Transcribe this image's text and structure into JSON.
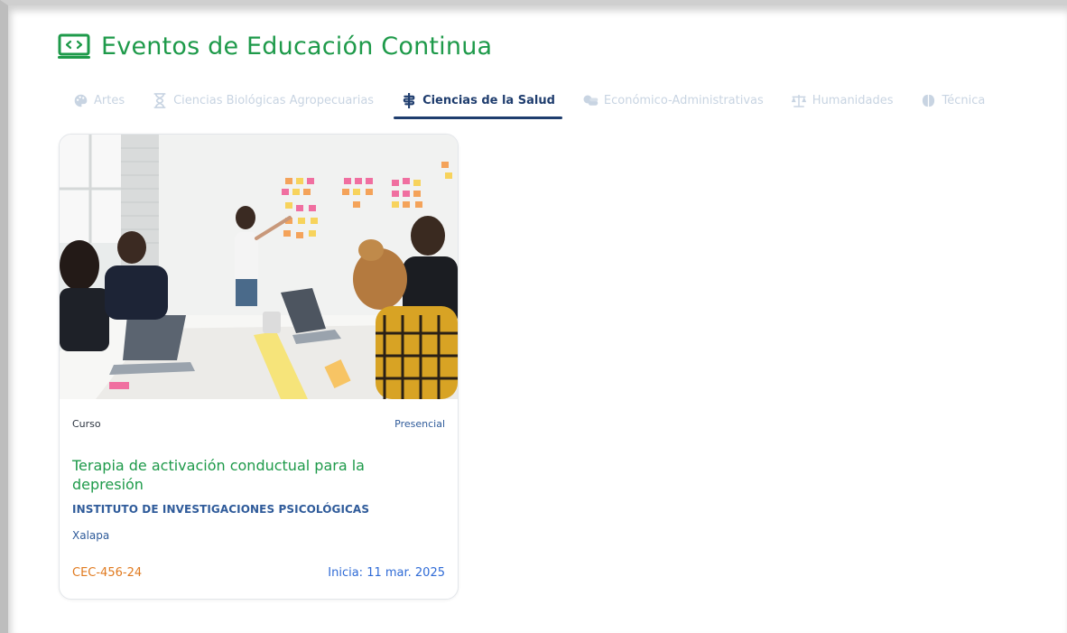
{
  "page": {
    "title": "Eventos de Educación Continua",
    "title_icon": "certificate-icon"
  },
  "tabs": [
    {
      "label": "Artes",
      "icon": "palette-icon",
      "active": false
    },
    {
      "label": "Ciencias Biológicas Agropecuarias",
      "icon": "hourglass-icon",
      "active": false
    },
    {
      "label": "Ciencias de la Salud",
      "icon": "medical-icon",
      "active": true
    },
    {
      "label": "Económico-Administrativas",
      "icon": "coins-icon",
      "active": false
    },
    {
      "label": "Humanidades",
      "icon": "scales-icon",
      "active": false
    },
    {
      "label": "Técnica",
      "icon": "brain-icon",
      "active": false
    }
  ],
  "colors": {
    "brand_green": "#1e9a4a",
    "active_tab": "#1f3d6e",
    "inactive_tab": "#c8d4e2",
    "code_orange": "#e07a1f",
    "link_blue": "#2f6bd6"
  },
  "card": {
    "image": "meeting-photo",
    "type": "Curso",
    "modality": "Presencial",
    "title": "Terapia de activación conductual para la depresión",
    "institute": "INSTITUTO DE INVESTIGACIONES PSICOLÓGICAS",
    "city": "Xalapa",
    "code": "CEC-456-24",
    "start": "Inicia: 11 mar. 2025"
  }
}
